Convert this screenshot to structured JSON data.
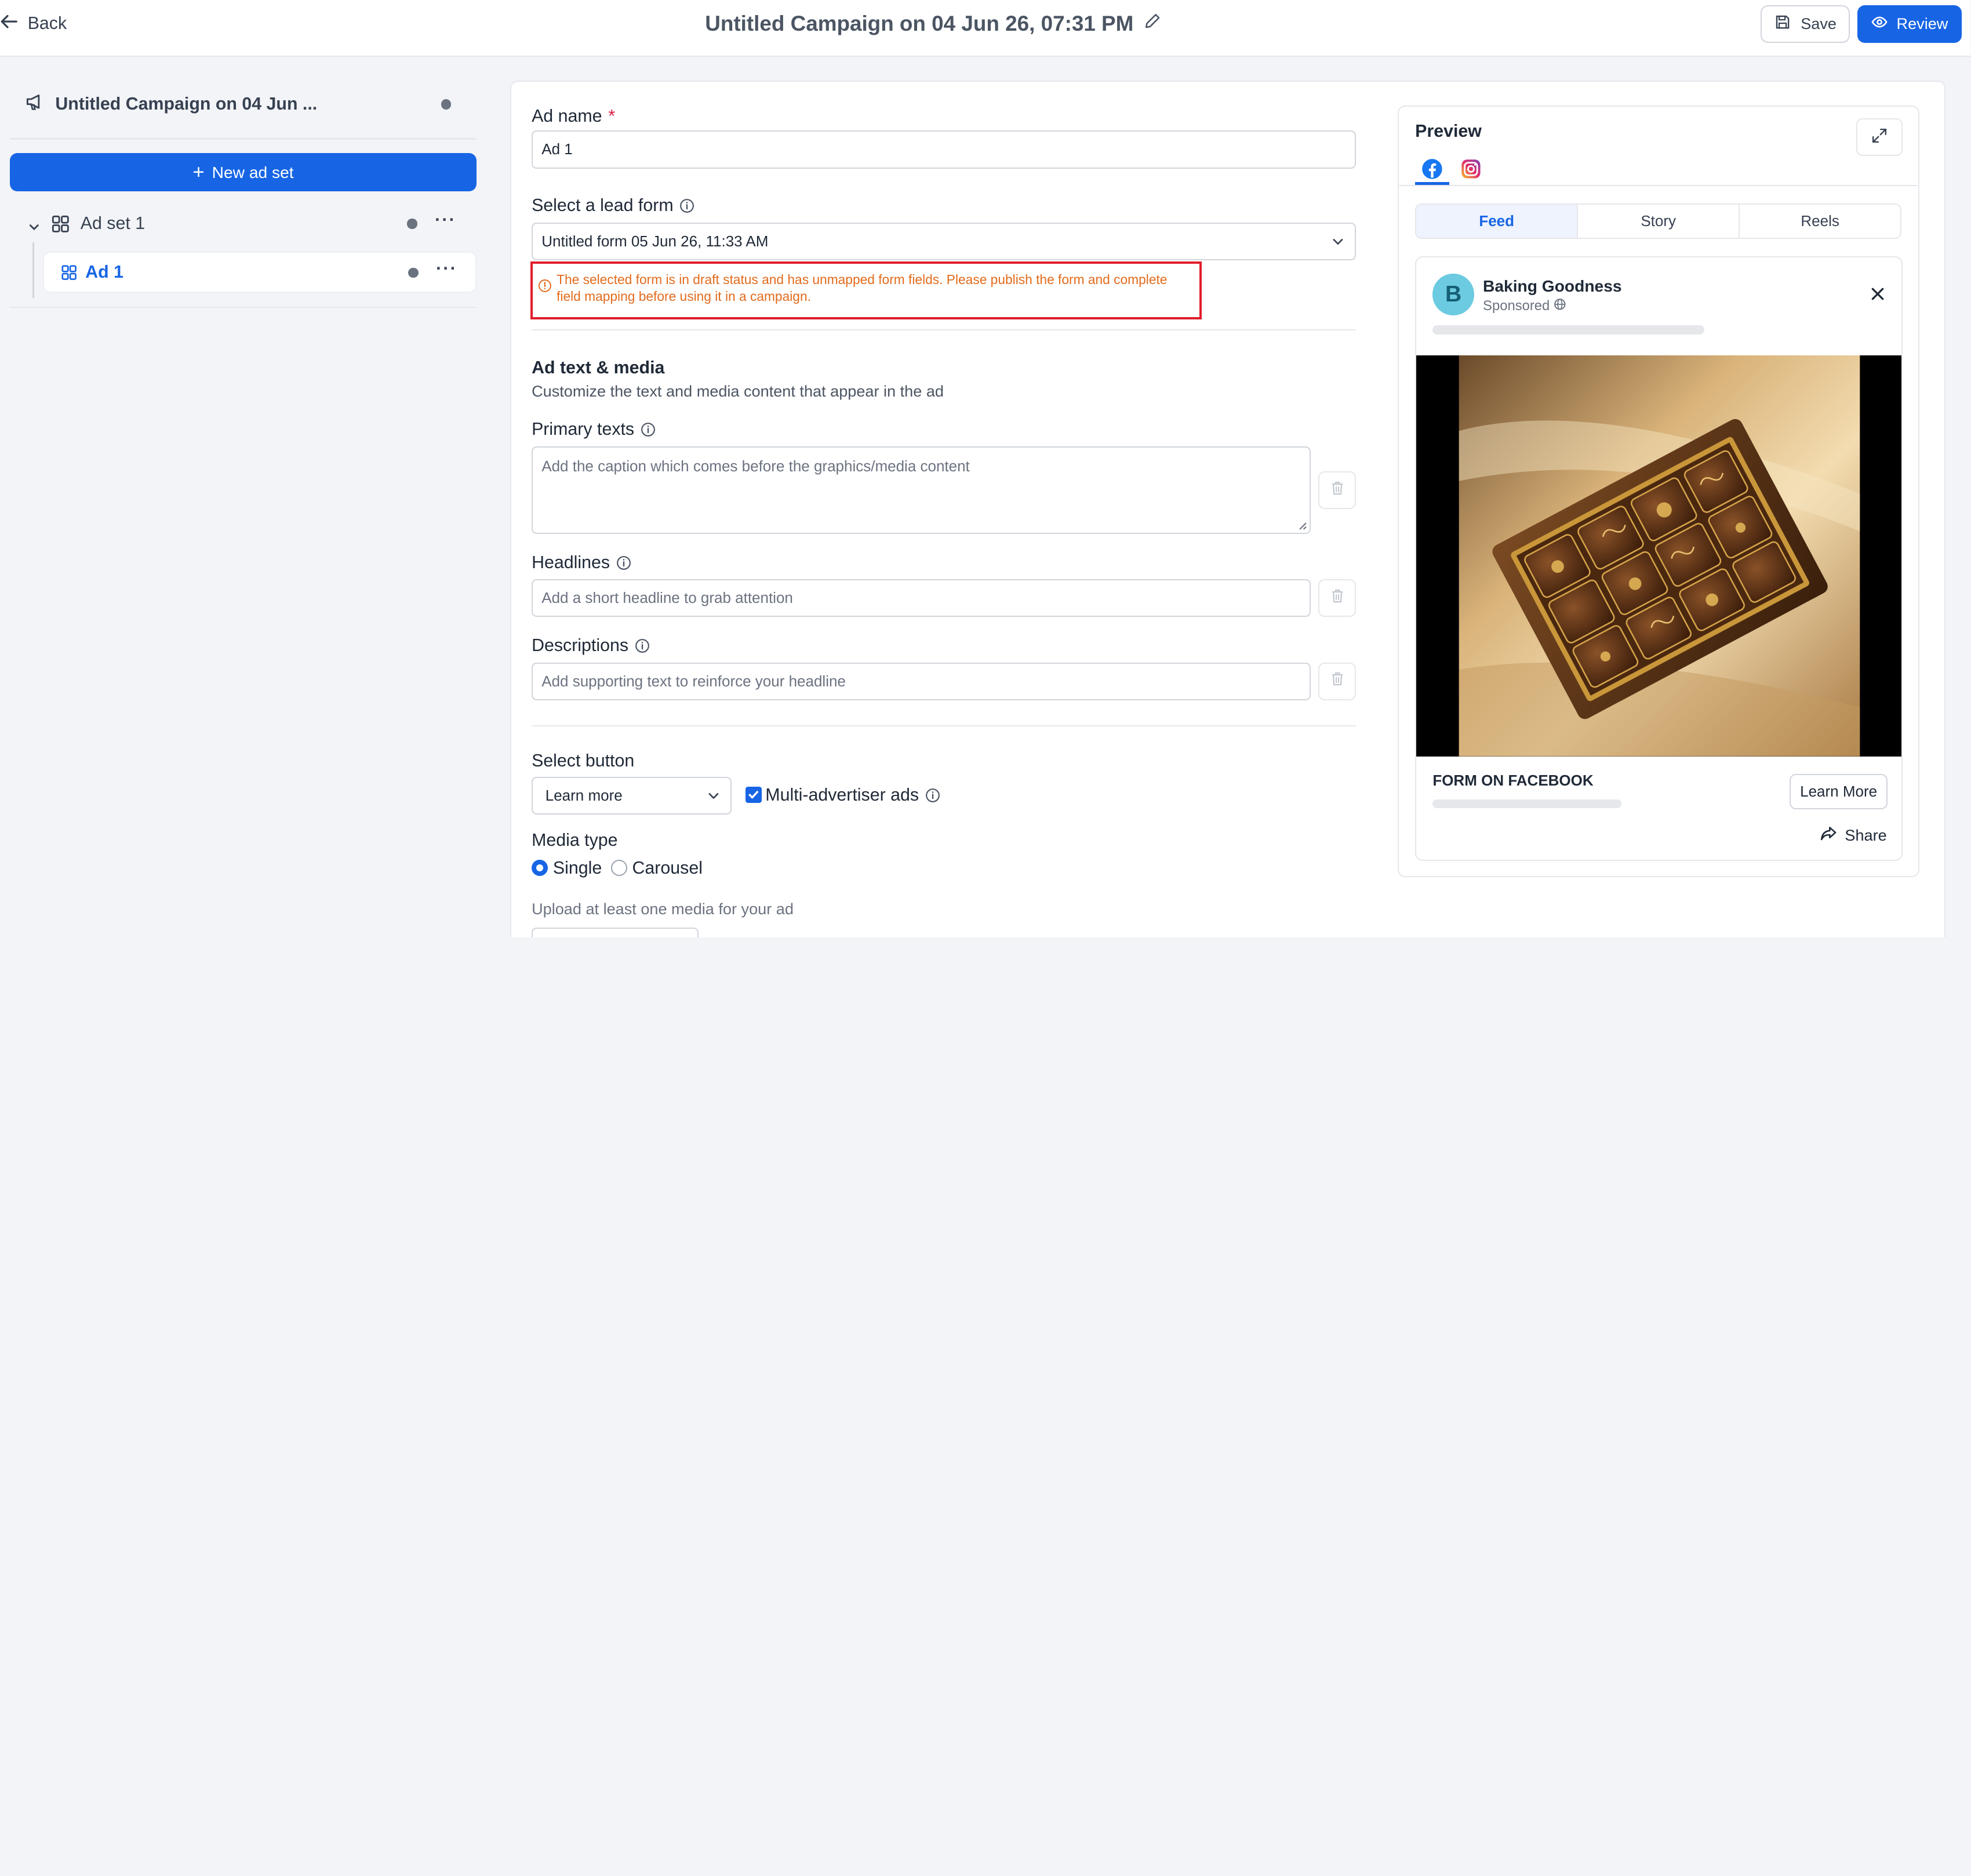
{
  "header": {
    "back_label": "Back",
    "title": "Untitled Campaign on 04 Jun 26, 07:31 PM",
    "save_label": "Save",
    "review_label": "Review"
  },
  "sidebar": {
    "campaign_name": "Untitled Campaign on 04 Jun ...",
    "new_ad_set_label": "New ad set",
    "ad_set_label": "Ad set 1",
    "ad_label": "Ad 1",
    "more_label": "···"
  },
  "form": {
    "ad_name_label": "Ad name",
    "required_mark": "*",
    "ad_name_value": "Ad 1",
    "lead_form_label": "Select a lead form",
    "lead_form_value": "Untitled form 05 Jun 26, 11:33 AM",
    "lead_form_error": "The selected form is in draft status and has unmapped form fields. Please publish the form and complete field mapping before using it in a campaign.",
    "ad_text_title": "Ad text & media",
    "ad_text_subtitle": "Customize the text and media content that appear in the ad",
    "primary_texts_label": "Primary texts",
    "primary_texts_placeholder": "Add the caption which comes before the graphics/media content",
    "headlines_label": "Headlines",
    "headlines_placeholder": "Add a short headline to grab attention",
    "descriptions_label": "Descriptions",
    "descriptions_placeholder": "Add supporting text to reinforce your headline",
    "select_button_label": "Select button",
    "select_button_value": "Learn more",
    "multi_advertiser_label": "Multi-advertiser ads",
    "multi_advertiser_checked": true,
    "media_type_label": "Media type",
    "media_single_label": "Single",
    "media_carousel_label": "Carousel",
    "media_selected": "Single",
    "upload_hint": "Upload at least one media for your ad"
  },
  "preview": {
    "title": "Preview",
    "platforms": [
      "facebook-icon",
      "instagram-icon"
    ],
    "selected_platform": "facebook",
    "placements": [
      "Feed",
      "Story",
      "Reels"
    ],
    "selected_placement": "Feed",
    "page_name": "Baking Goodness",
    "avatar_letter": "B",
    "sponsored_label": "Sponsored",
    "form_title": "FORM ON FACEBOOK",
    "cta_label": "Learn More",
    "share_label": "Share"
  },
  "colors": {
    "accent": "#1765e5",
    "error_border": "#e11d2b",
    "error_text": "#e26b1d"
  }
}
